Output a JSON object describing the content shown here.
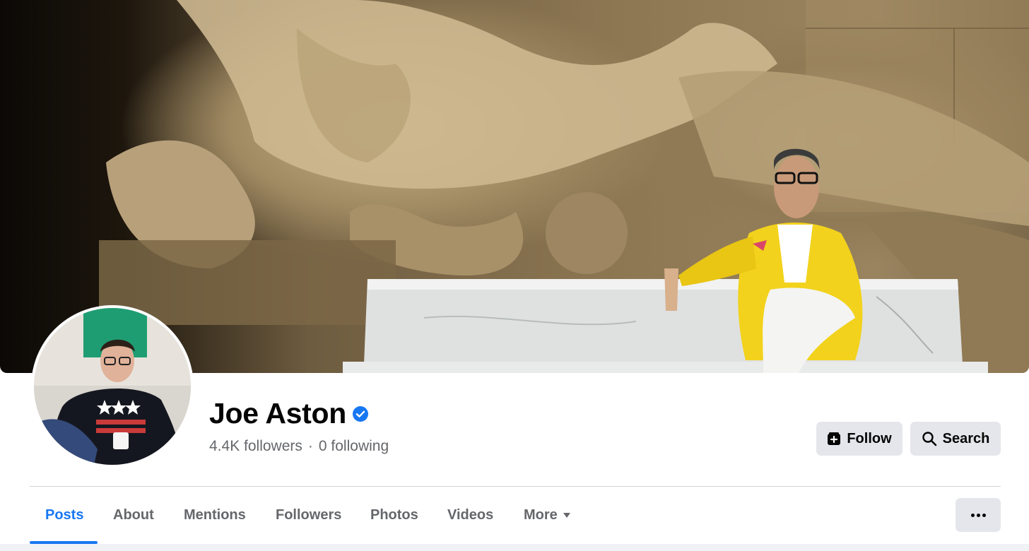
{
  "profile": {
    "name": "Joe Aston",
    "followers": "4.4K followers",
    "separator": "·",
    "following": "0 following"
  },
  "actions": {
    "follow_label": "Follow",
    "search_label": "Search"
  },
  "tabs": [
    {
      "label": "Posts",
      "active": true
    },
    {
      "label": "About"
    },
    {
      "label": "Mentions"
    },
    {
      "label": "Followers"
    },
    {
      "label": "Photos"
    },
    {
      "label": "Videos"
    },
    {
      "label": "More"
    }
  ],
  "colors": {
    "accent": "#1877f2",
    "button_bg": "#e4e6eb",
    "secondary_text": "#65676b"
  },
  "icons": {
    "verified": "verified-badge-icon",
    "follow": "follow-plus-icon",
    "search": "search-icon",
    "more_caret": "caret-down-icon",
    "menu": "ellipsis-icon"
  }
}
